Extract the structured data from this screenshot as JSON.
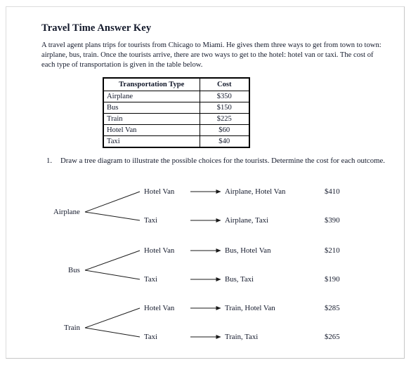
{
  "document": {
    "title": "Travel Time Answer Key",
    "intro": "A travel agent plans trips for tourists from Chicago to Miami.  He gives them three ways to get from town to town:  airplane, bus, train.  Once the tourists arrive, there are two ways to get to the hotel:  hotel van or taxi.  The cost of each type of transportation is given in the table below."
  },
  "cost_table": {
    "headers": [
      "Transportation Type",
      "Cost"
    ],
    "rows": [
      {
        "type": "Airplane",
        "cost": "$350"
      },
      {
        "type": "Bus",
        "cost": "$150"
      },
      {
        "type": "Train",
        "cost": "$225"
      },
      {
        "type": "Hotel Van",
        "cost": "$60"
      },
      {
        "type": "Taxi",
        "cost": "$40"
      }
    ]
  },
  "question": {
    "number": "1.",
    "text": "Draw a tree diagram to illustrate the possible choices for the tourists.  Determine the cost for each outcome."
  },
  "tree": {
    "branches": [
      {
        "root": "Airplane",
        "children": [
          {
            "mid": "Hotel Van",
            "outcome": "Airplane, Hotel Van",
            "cost": "$410"
          },
          {
            "mid": "Taxi",
            "outcome": "Airplane, Taxi",
            "cost": "$390"
          }
        ]
      },
      {
        "root": "Bus",
        "children": [
          {
            "mid": "Hotel Van",
            "outcome": "Bus, Hotel Van",
            "cost": "$210"
          },
          {
            "mid": "Taxi",
            "outcome": "Bus, Taxi",
            "cost": "$190"
          }
        ]
      },
      {
        "root": "Train",
        "children": [
          {
            "mid": "Hotel Van",
            "outcome": "Train, Hotel Van",
            "cost": "$285"
          },
          {
            "mid": "Taxi",
            "outcome": "Train, Taxi",
            "cost": "$265"
          }
        ]
      }
    ]
  },
  "colors": {
    "text": "#13192b",
    "page_border": "#c6c6c6",
    "table_border": "#000000"
  }
}
